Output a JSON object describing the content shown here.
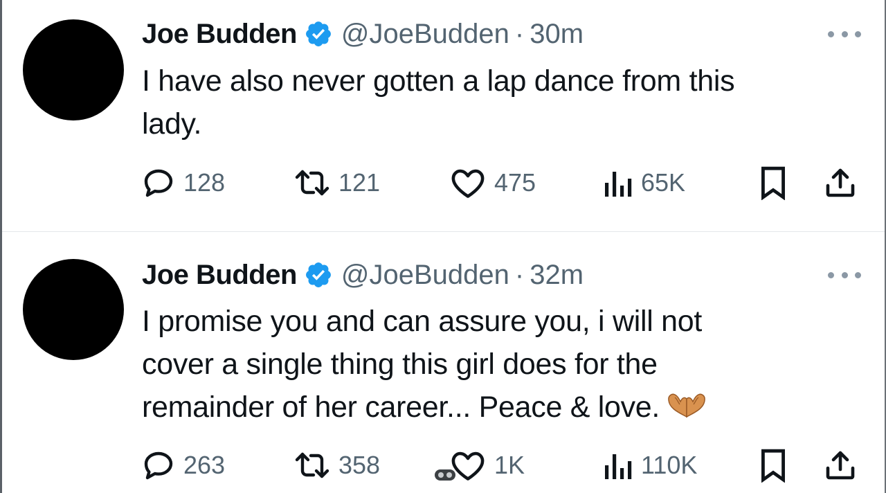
{
  "tweets": [
    {
      "name": "Joe Budden",
      "handle": "@JoeBudden",
      "separator": "·",
      "time": "30m",
      "text_lines": [
        "I have also never gotten a lap dance from this",
        "lady."
      ],
      "stats": {
        "replies": "128",
        "retweets": "121",
        "likes": "475",
        "views": "65K"
      }
    },
    {
      "name": "Joe Budden",
      "handle": "@JoeBudden",
      "separator": "·",
      "time": "32m",
      "text_lines": [
        "I promise you and can assure you, i will not",
        "cover a single thing this girl does for the",
        "remainder of her career... Peace & love."
      ],
      "emoji": "heart-hands",
      "stats": {
        "replies": "263",
        "retweets": "358",
        "likes": "1K",
        "views": "110K"
      }
    }
  ],
  "colors": {
    "text": "#0f1419",
    "secondary": "#536471",
    "verified": "#1d9bf0",
    "divider": "#e4e7ea"
  },
  "icons": [
    "verified-badge-icon",
    "more-icon",
    "reply-icon",
    "retweet-icon",
    "like-icon",
    "views-icon",
    "bookmark-icon",
    "share-icon",
    "heart-hands-emoji"
  ]
}
